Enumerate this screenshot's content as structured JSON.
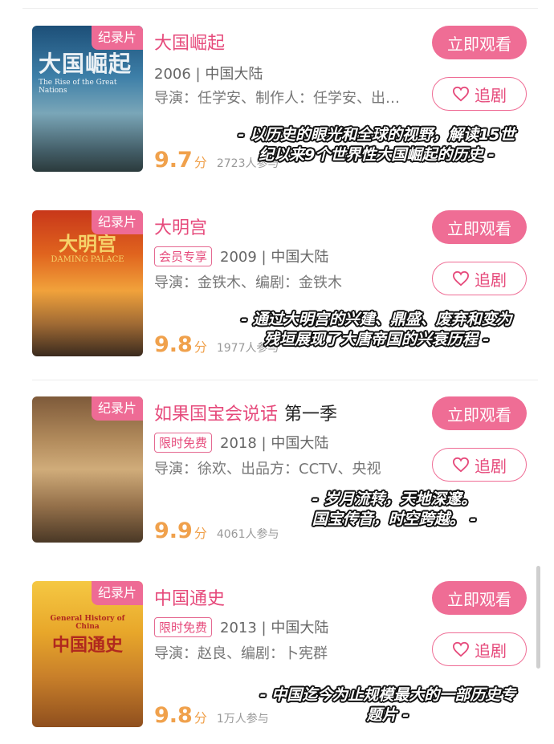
{
  "items": [
    {
      "badge": "纪录片",
      "title": "大国崛起",
      "title_suffix": "",
      "tag": "",
      "year_region": "2006 | 中国大陆",
      "credits": "导演：任学安、制作人：任学安、出…",
      "score": "9.7",
      "score_unit": "分",
      "participants": "2723人参与",
      "watch_label": "立即观看",
      "follow_label": "追剧",
      "overlay_line1": "- 以历史的眼光和全球的视野，解读15世",
      "overlay_line2": "纪以来9个世界性大国崛起的历史 -",
      "poster_title": "大国崛起",
      "poster_caption": "The Rise of the Great Nations"
    },
    {
      "badge": "纪录片",
      "title": "大明宫",
      "title_suffix": "",
      "tag": "会员专享",
      "year_region": "2009 | 中国大陆",
      "credits": "导演：金铁木、编剧：金铁木",
      "score": "9.8",
      "score_unit": "分",
      "participants": "1977人参与",
      "watch_label": "立即观看",
      "follow_label": "追剧",
      "overlay_line1": "- 通过大明宫的兴建、鼎盛、废弃和变为",
      "overlay_line2": "残垣展现了大唐帝国的兴衰历程 -",
      "poster_title": "大明宫",
      "poster_caption": "DAMING PALACE"
    },
    {
      "badge": "纪录片",
      "title": "如果国宝会说话",
      "title_suffix": "第一季",
      "tag": "限时免费",
      "year_region": "2018 | 中国大陆",
      "credits": "导演：徐欢、出品方：CCTV、央视",
      "score": "9.9",
      "score_unit": "分",
      "participants": "4061人参与",
      "watch_label": "立即观看",
      "follow_label": "追剧",
      "overlay_line1": "- 岁月流转，天地深邃。",
      "overlay_line2": "国宝传音，时空跨越。 -",
      "poster_title": "",
      "poster_caption": ""
    },
    {
      "badge": "纪录片",
      "title": "中国通史",
      "title_suffix": "",
      "tag": "限时免费",
      "year_region": "2013 | 中国大陆",
      "credits": "导演：赵良、编剧：卜宪群",
      "score": "9.8",
      "score_unit": "分",
      "participants": "1万人参与",
      "watch_label": "立即观看",
      "follow_label": "追剧",
      "overlay_line1": "- 中国迄今为止规模最大的一部历史专",
      "overlay_line2": "题片 -",
      "poster_title": "中国通史",
      "poster_caption": "General History of China"
    }
  ],
  "colors": {
    "accent": "#ef6d95",
    "title": "#e64a7b",
    "score": "#f0a14c"
  }
}
